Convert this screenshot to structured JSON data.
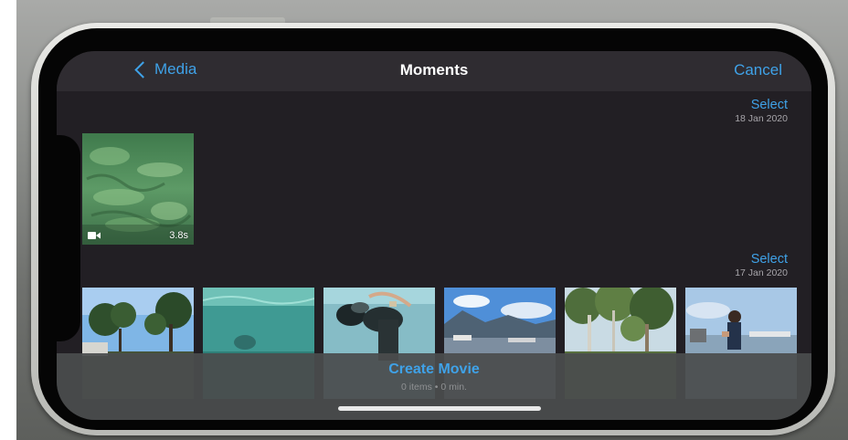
{
  "nav": {
    "back_label": "Media",
    "title": "Moments",
    "cancel_label": "Cancel"
  },
  "sections": [
    {
      "select_label": "Select",
      "date": "18 Jan 2020",
      "items": [
        {
          "type": "video",
          "duration": "3.8s",
          "scene": "underwater sunlit seagrass"
        }
      ]
    },
    {
      "select_label": "Select",
      "date": "17 Jan 2020",
      "items": [
        {
          "type": "photo",
          "scene": "trees and blue sky"
        },
        {
          "type": "photo",
          "scene": "turquoise underwater swimmer"
        },
        {
          "type": "photo",
          "scene": "snorkeler underwater"
        },
        {
          "type": "photo",
          "scene": "bay with mountains and clouds"
        },
        {
          "type": "photo",
          "scene": "tropical forest"
        },
        {
          "type": "photo",
          "scene": "boy at waterfront"
        }
      ]
    }
  ],
  "bottom": {
    "create_label": "Create Movie",
    "count_text": "0 items • 0 min."
  },
  "colors": {
    "accent": "#3fa2e8",
    "screen_bg": "#221f24",
    "nav_bg": "#2f2c31"
  },
  "icons": [
    "chevron-left-icon",
    "video-camera-icon"
  ]
}
